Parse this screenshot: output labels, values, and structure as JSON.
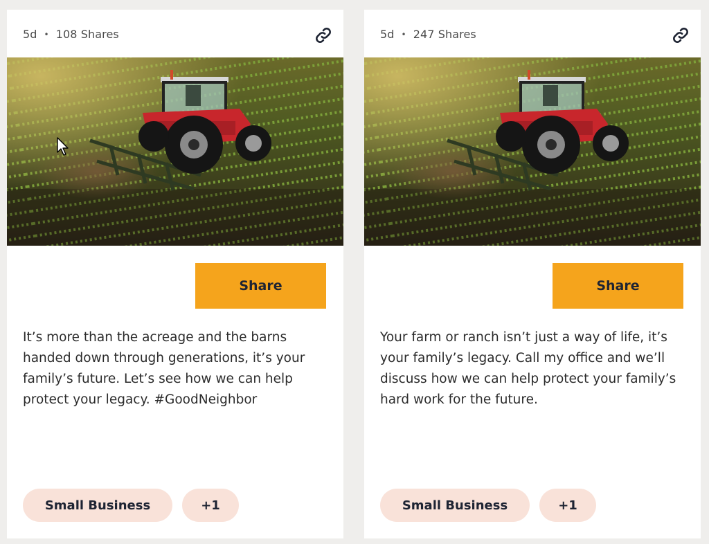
{
  "colors": {
    "background": "#efeeec",
    "card": "#ffffff",
    "share_button": "#f5a41c",
    "tag_background": "#f9e2d9",
    "text_dark": "#1e2433"
  },
  "posts": [
    {
      "age": "5d",
      "separator": "•",
      "shares": "108 Shares",
      "link_icon": "link-icon",
      "image": "red-tractor-in-field",
      "share_label": "Share",
      "text": "It’s more than the acreage and the barns handed down through generations, it’s your family’s future. Let’s see how we can help protect your legacy. #GoodNeighbor",
      "tags": [
        "Small Business",
        "+1"
      ]
    },
    {
      "age": "5d",
      "separator": "•",
      "shares": "247 Shares",
      "link_icon": "link-icon",
      "image": "red-tractor-in-field",
      "share_label": "Share",
      "text": "Your farm or ranch isn’t just a way of life, it’s your family’s legacy. Call my office and we’ll discuss how we can help protect your family’s hard work for the future.",
      "tags": [
        "Small Business",
        "+1"
      ]
    }
  ]
}
